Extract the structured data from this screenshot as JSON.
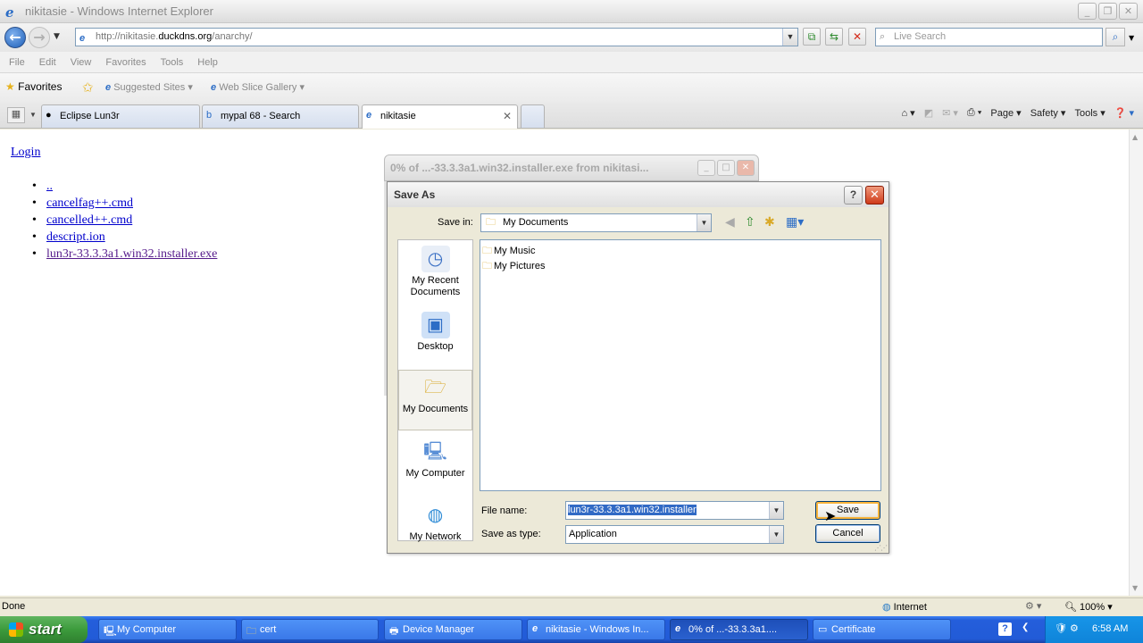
{
  "window": {
    "title": "nikitasie - Windows Internet Explorer"
  },
  "address": {
    "url_prefix": "http://nikitasie.",
    "url_host": "duckdns.org",
    "url_path": "/anarchy/",
    "search_placeholder": "Live Search"
  },
  "menu": [
    "File",
    "Edit",
    "View",
    "Favorites",
    "Tools",
    "Help"
  ],
  "favorites": {
    "label": "Favorites",
    "items": [
      "Suggested Sites",
      "Web Slice Gallery"
    ]
  },
  "tabs": [
    {
      "label": "Eclipse Lun3r"
    },
    {
      "label": "mypal 68 - Search"
    },
    {
      "label": "nikitasie"
    }
  ],
  "commandbar": {
    "page": "Page",
    "safety": "Safety",
    "tools": "Tools"
  },
  "page": {
    "login": "Login",
    "files": [
      "..",
      "cancelfag++.cmd",
      "cancelled++.cmd",
      "descript.ion",
      "lun3r-33.3.3a1.win32.installer.exe"
    ]
  },
  "download_window": {
    "title": "0% of ...-33.3.3a1.win32.installer.exe from nikitasi..."
  },
  "save_dialog": {
    "title": "Save As",
    "save_in_label": "Save in:",
    "save_in_value": "My Documents",
    "places": [
      {
        "label": "My Recent Documents"
      },
      {
        "label": "Desktop"
      },
      {
        "label": "My Documents"
      },
      {
        "label": "My Computer"
      },
      {
        "label": "My Network"
      }
    ],
    "files": [
      "My Music",
      "My Pictures"
    ],
    "filename_label": "File name:",
    "filename_value": "lun3r-33.3.3a1.win32.installer",
    "type_label": "Save as type:",
    "type_value": "Application",
    "save_button": "Save",
    "cancel_button": "Cancel"
  },
  "statusbar": {
    "text": "Done",
    "zone": "Internet",
    "zoom": "100%"
  },
  "taskbar": {
    "start": "start",
    "tasks": [
      "My Computer",
      "cert",
      "Device Manager",
      "nikitasie - Windows In...",
      "0% of ...-33.3.3a1....",
      "Certificate"
    ],
    "clock": "6:58 AM"
  }
}
